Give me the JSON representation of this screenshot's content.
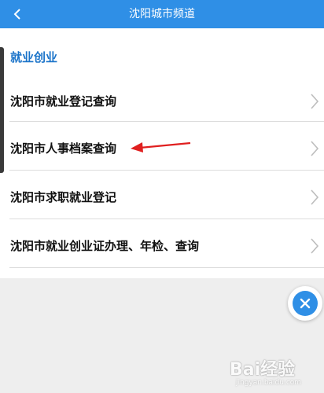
{
  "header": {
    "title": "沈阳城市频道",
    "back_icon": "chevron-left-icon"
  },
  "section": {
    "title": "就业创业"
  },
  "items": [
    {
      "label": "沈阳市就业登记查询"
    },
    {
      "label": "沈阳市人事档案查询"
    },
    {
      "label": "沈阳市求职就业登记"
    },
    {
      "label": "沈阳市就业创业证办理、年检、查询"
    }
  ],
  "close_button": {
    "icon": "close-icon"
  },
  "watermark": {
    "logo_text": "Bai经验",
    "url_text": "jingyan.baidu.com"
  },
  "colors": {
    "header_bg": "#2f8fe6",
    "section_title": "#1a73c9",
    "annotation_arrow": "#e02020"
  }
}
